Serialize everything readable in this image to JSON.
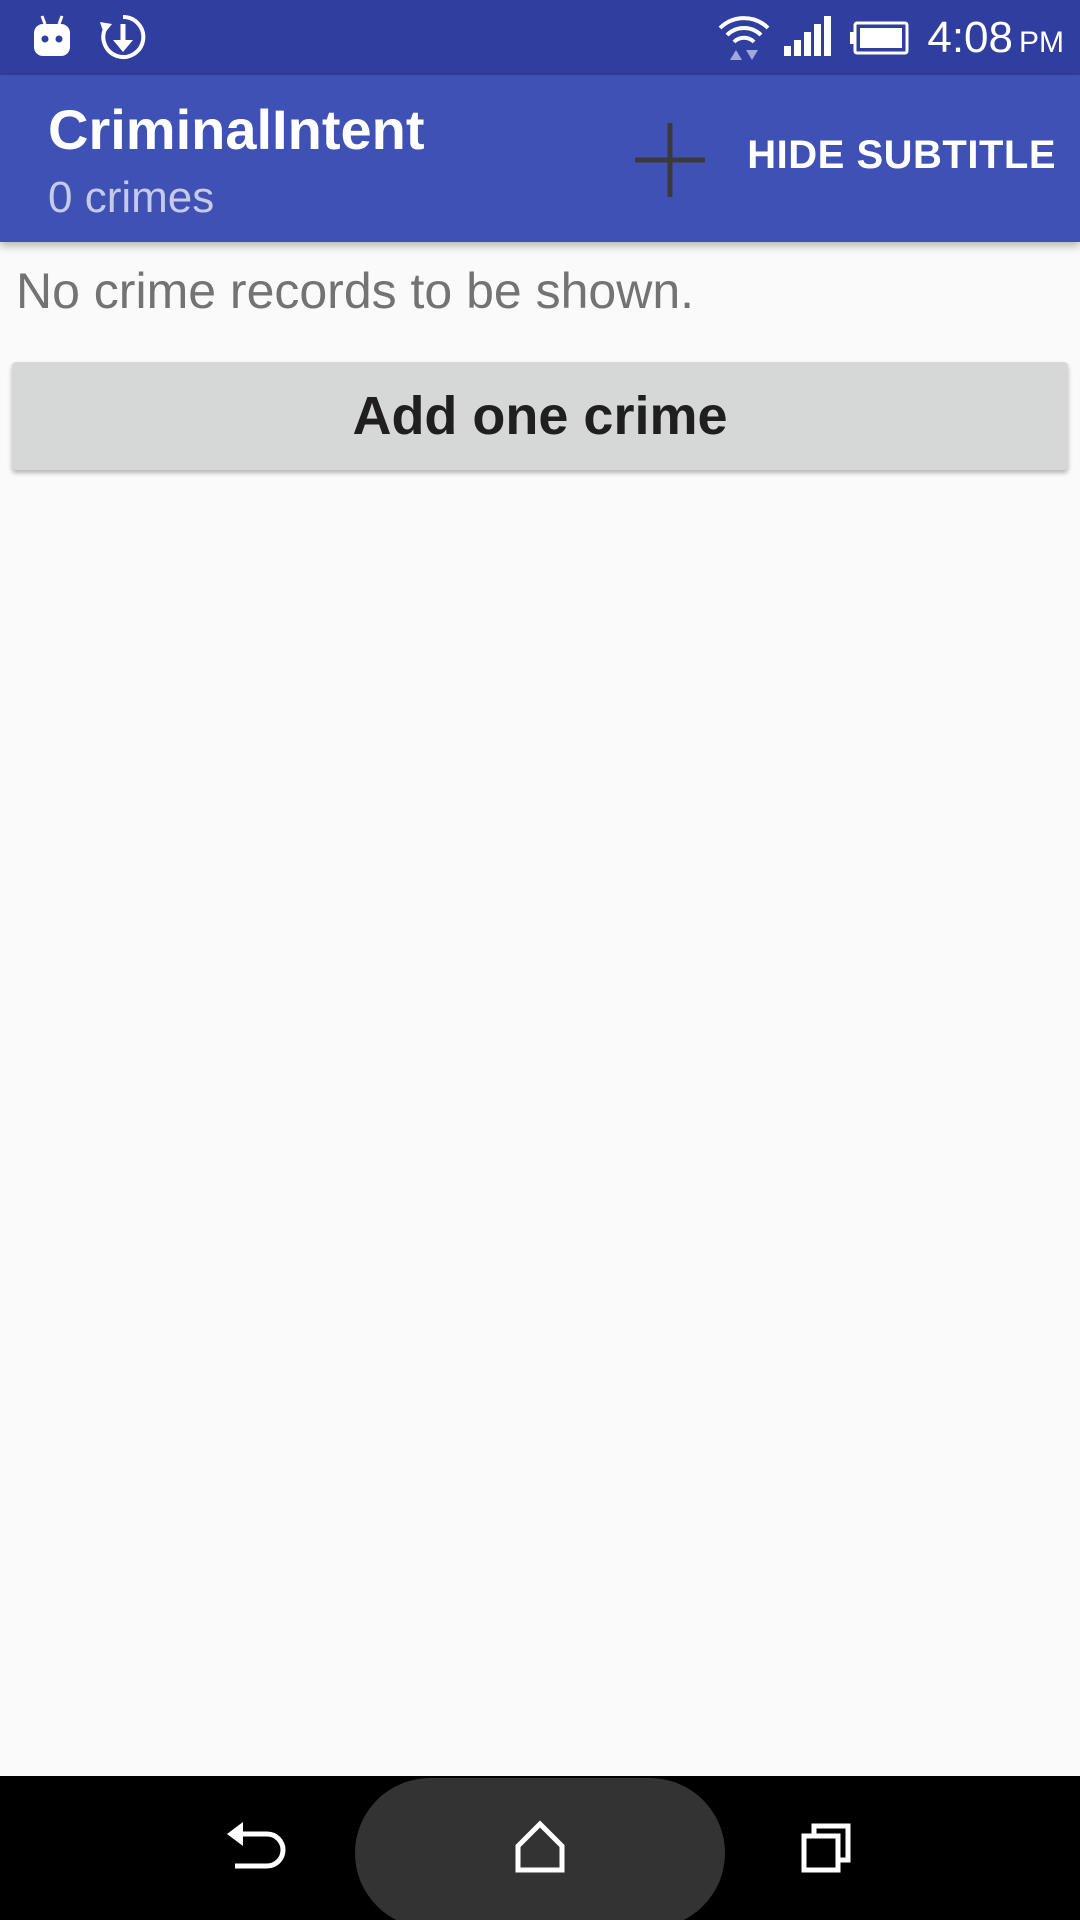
{
  "status_bar": {
    "time": "4:08",
    "ampm": "PM",
    "icons": [
      "android-notification-icon",
      "sync-download-icon",
      "wifi-icon",
      "cell-signal-icon",
      "battery-icon"
    ]
  },
  "app_bar": {
    "title": "CriminalIntent",
    "subtitle": "0 crimes",
    "add_icon": "plus-icon",
    "hide_subtitle_label": "HIDE SUBTITLE",
    "background_color": "#3f51b5",
    "status_color": "#303f9f"
  },
  "content": {
    "empty_message": "No crime records to be shown.",
    "add_button_label": "Add one crime"
  },
  "nav_bar": {
    "icons": [
      "back-icon",
      "home-icon",
      "recents-icon"
    ]
  }
}
